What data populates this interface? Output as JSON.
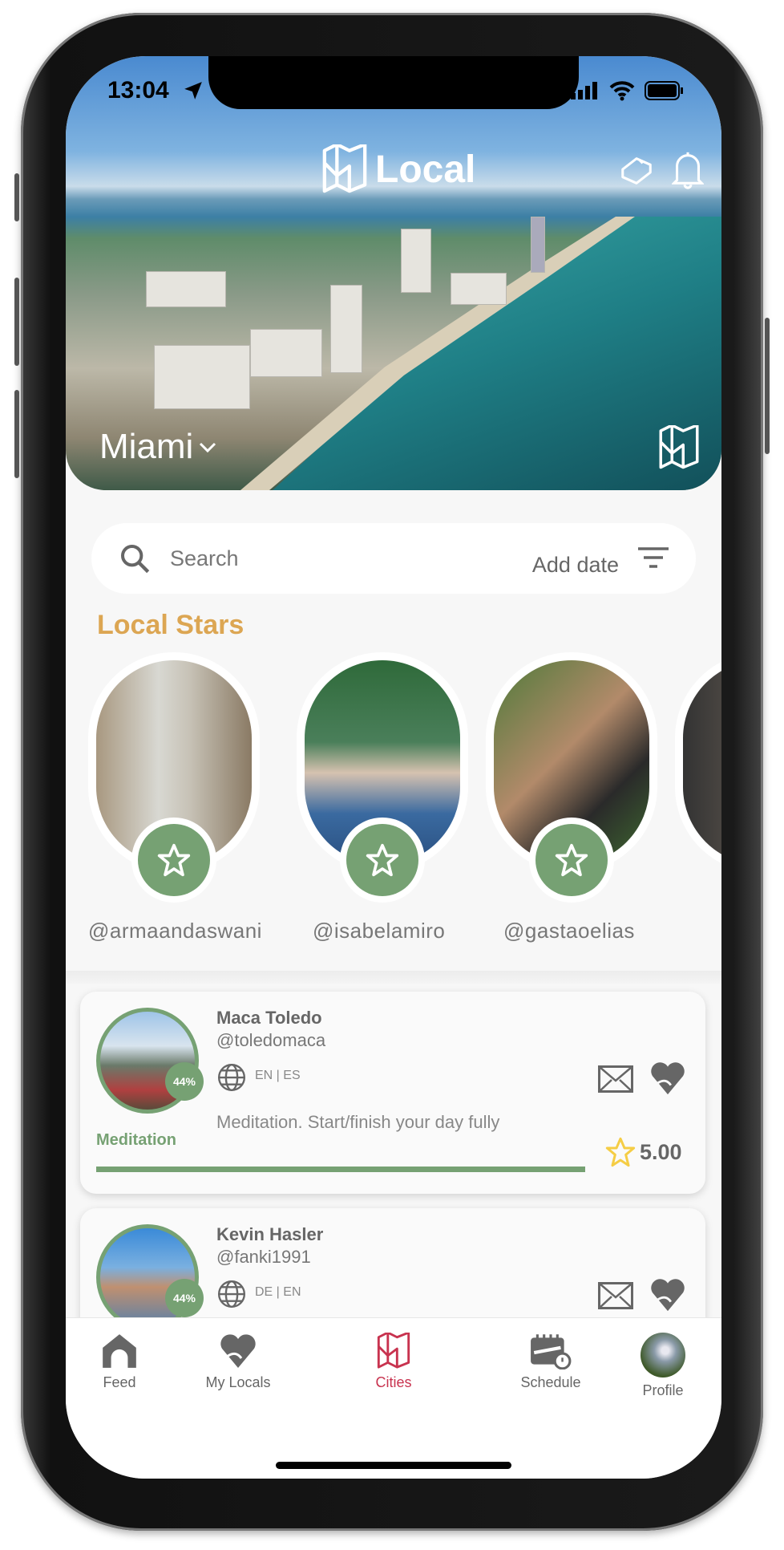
{
  "status_bar": {
    "time": "13:04"
  },
  "header": {
    "brand": "Local",
    "city": "Miami"
  },
  "search": {
    "placeholder": "Search",
    "add_date": "Add date"
  },
  "local_stars": {
    "title": "Local Stars",
    "items": [
      {
        "handle": "@armaandaswani"
      },
      {
        "handle": "@isabelamiro"
      },
      {
        "handle": "@gastaoelias"
      }
    ]
  },
  "locals": [
    {
      "name": "Maca Toledo",
      "handle": "@toledomaca",
      "match": "44%",
      "languages": "EN | ES",
      "description": "Meditation. Start/finish your day fully",
      "category": "Meditation",
      "rating": "5.00",
      "progress": 0.82
    },
    {
      "name": "Kevin Hasler",
      "handle": "@fanki1991",
      "match": "44%",
      "languages": "DE | EN"
    }
  ],
  "tabs": [
    {
      "label": "Feed",
      "icon": "home-icon"
    },
    {
      "label": "My Locals",
      "icon": "heart-icon"
    },
    {
      "label": "Cities",
      "icon": "map-icon",
      "active": true
    },
    {
      "label": "Schedule",
      "icon": "calendar-icon"
    },
    {
      "label": "Profile",
      "icon": "avatar"
    }
  ],
  "colors": {
    "accent_green": "#76a173",
    "stars_title": "#dca653",
    "active_tab": "#c8334f",
    "rating_star": "#f5cd45"
  }
}
